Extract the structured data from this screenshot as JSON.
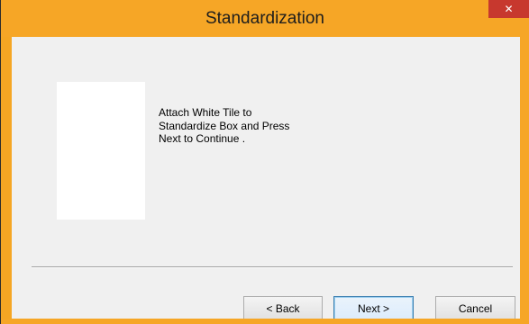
{
  "window": {
    "title": "Standardization",
    "close_glyph": "✕"
  },
  "content": {
    "instruction_lines": [
      "Attach White Tile to",
      "Standardize Box and Press",
      "Next to Continue ."
    ]
  },
  "buttons": {
    "back_label": "< Back",
    "next_label": "Next >",
    "cancel_label": "Cancel"
  },
  "colors": {
    "frame_accent": "#f6a626",
    "close_button": "#c7382e",
    "dialog_background": "#f0f0f0"
  }
}
